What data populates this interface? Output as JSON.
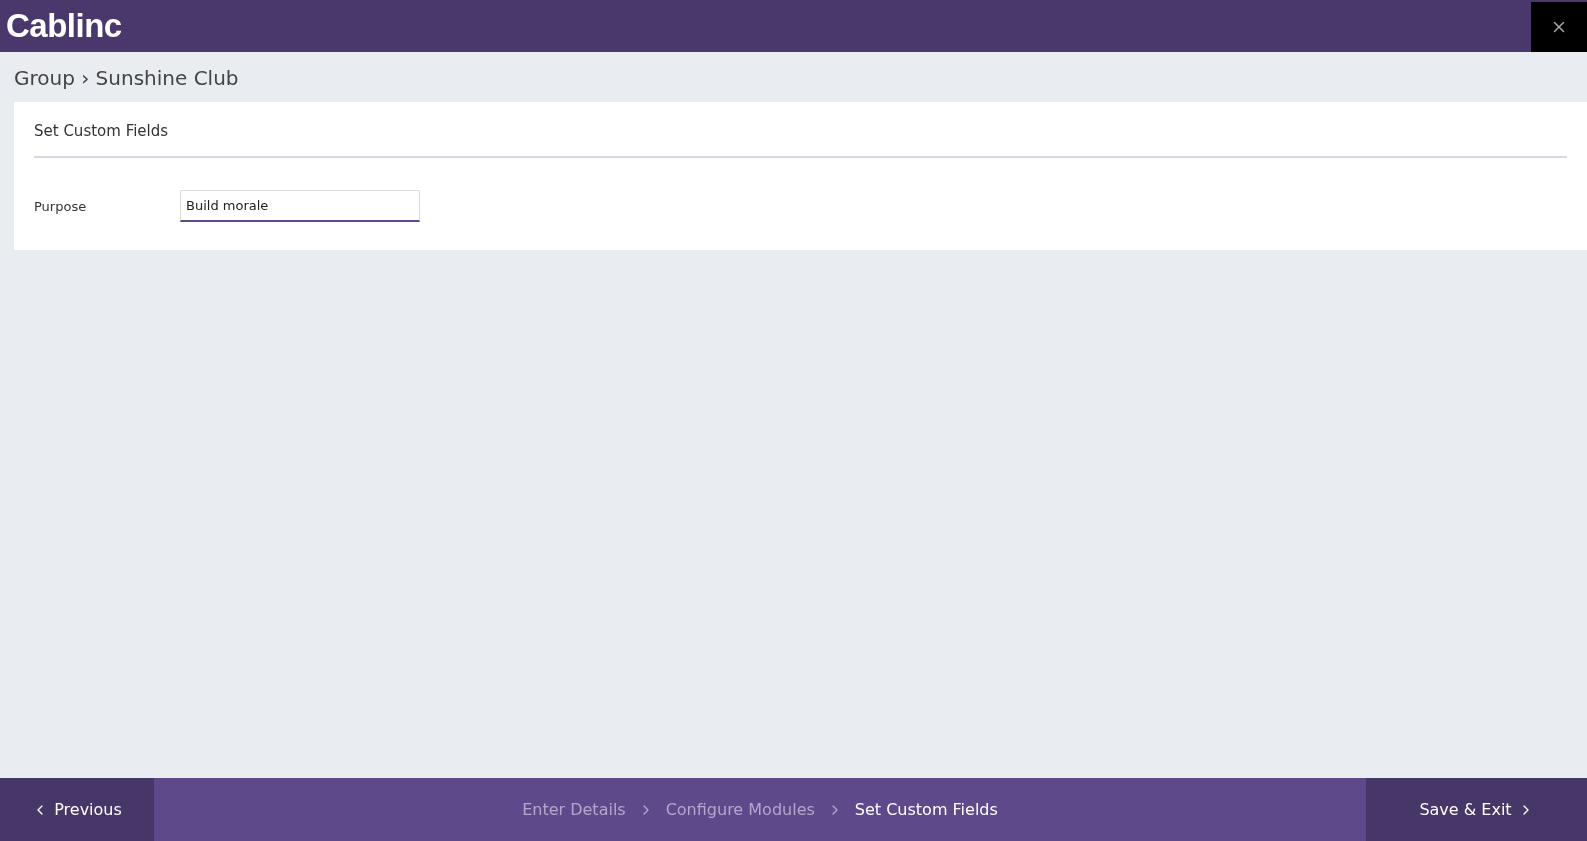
{
  "header": {
    "logo": "Cablinc"
  },
  "breadcrumb": "Group › Sunshine Club",
  "card": {
    "title": "Set Custom Fields",
    "fields": [
      {
        "label": "Purpose",
        "value": "Build morale"
      }
    ]
  },
  "footer": {
    "previous": "Previous",
    "save": "Save & Exit",
    "steps": [
      {
        "label": "Enter Details",
        "selected": false
      },
      {
        "label": "Configure Modules",
        "selected": false
      },
      {
        "label": "Set Custom Fields",
        "selected": true
      }
    ]
  }
}
